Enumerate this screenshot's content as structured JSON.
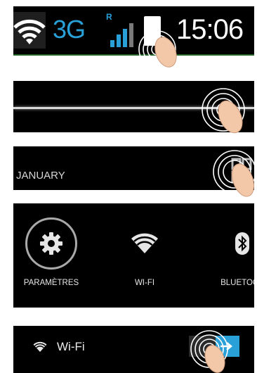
{
  "status_bar": {
    "network_type": "3G",
    "roaming_indicator": "R",
    "time": "15:06",
    "icons": [
      "wifi-icon",
      "signal-bars-icon",
      "battery-icon"
    ],
    "accent_color": "#2aa0d8"
  },
  "date_row": {
    "month": "JANUARY"
  },
  "quick_settings": {
    "tiles": [
      {
        "label": "PARAMÈTRES",
        "icon": "gear-icon"
      },
      {
        "label": "WI-FI",
        "icon": "wifi-icon"
      },
      {
        "label": "BLUETOOT",
        "icon": "bluetooth-icon"
      }
    ]
  },
  "wifi_row": {
    "label": "Wi-Fi",
    "toggle_state": "on",
    "toggle_color": "#2aa0d8"
  }
}
